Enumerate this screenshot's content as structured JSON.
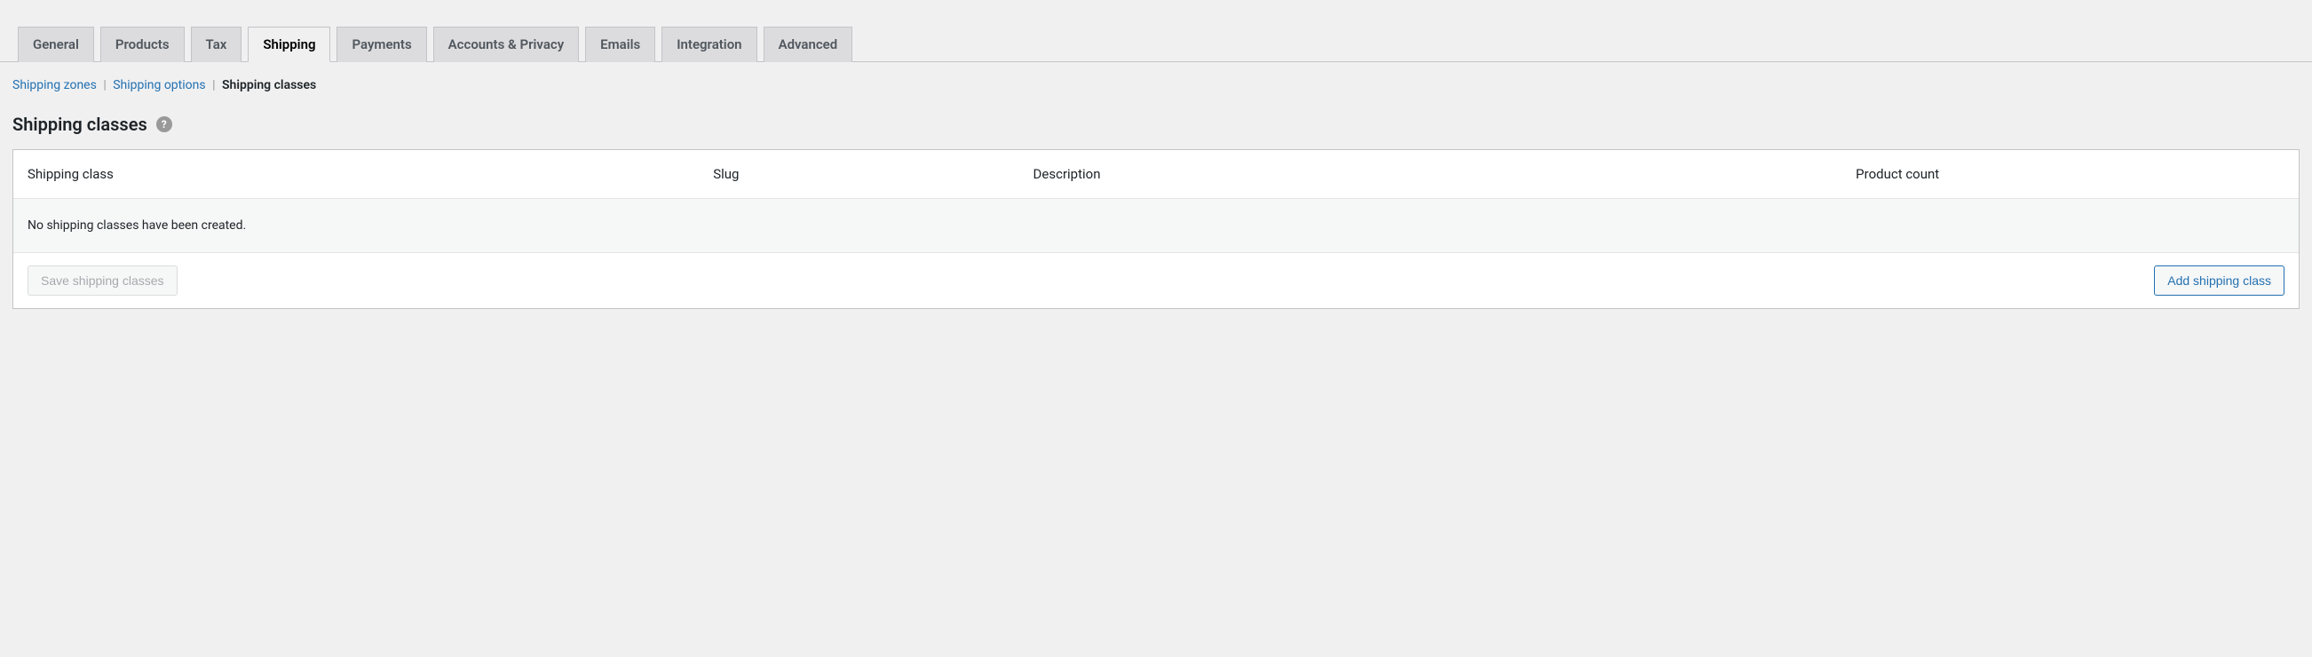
{
  "tabs": [
    {
      "label": "General"
    },
    {
      "label": "Products"
    },
    {
      "label": "Tax"
    },
    {
      "label": "Shipping"
    },
    {
      "label": "Payments"
    },
    {
      "label": "Accounts & Privacy"
    },
    {
      "label": "Emails"
    },
    {
      "label": "Integration"
    },
    {
      "label": "Advanced"
    }
  ],
  "subnav": {
    "zones": "Shipping zones",
    "options": "Shipping options",
    "classes": "Shipping classes"
  },
  "page": {
    "title": "Shipping classes",
    "help": "?"
  },
  "table": {
    "headers": {
      "class": "Shipping class",
      "slug": "Slug",
      "description": "Description",
      "count": "Product count"
    },
    "empty": "No shipping classes have been created."
  },
  "buttons": {
    "save": "Save shipping classes",
    "add": "Add shipping class"
  }
}
